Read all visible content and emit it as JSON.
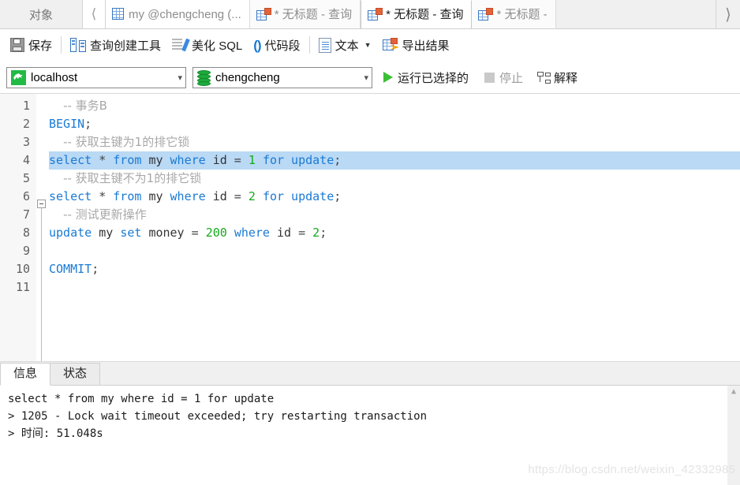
{
  "tabbar": {
    "object_label": "对象",
    "nav_left_icon": "chevron-left-icon",
    "nav_right_icon": "chevron-right-icon",
    "tabs": [
      {
        "label": "my @chengcheng (...",
        "icon": "table-grid-icon",
        "active": false
      },
      {
        "label": "* 无标题 - 查询",
        "icon": "query-table-icon",
        "active": false
      },
      {
        "label": "* 无标题 - 查询",
        "icon": "query-table-icon",
        "active": true
      },
      {
        "label": "* 无标题 -",
        "icon": "query-table-icon",
        "active": false
      }
    ]
  },
  "toolbar": {
    "save_label": "保存",
    "query_builder_label": "查询创建工具",
    "beautify_label": "美化 SQL",
    "code_snippet_label": "代码段",
    "text_label": "文本",
    "export_label": "导出结果"
  },
  "connbar": {
    "host_value": "localhost",
    "database_value": "chengcheng",
    "run_selected_label": "运行已选择的",
    "stop_label": "停止",
    "explain_label": "解释"
  },
  "editor": {
    "lines": [
      {
        "n": "1",
        "tokens": [
          {
            "t": "  ",
            "c": "pl"
          },
          {
            "t": "-- 事务B",
            "c": "cm"
          }
        ]
      },
      {
        "n": "2",
        "tokens": [
          {
            "t": "BEGIN",
            "c": "k"
          },
          {
            "t": ";",
            "c": "op"
          }
        ]
      },
      {
        "n": "3",
        "tokens": [
          {
            "t": "  ",
            "c": "pl"
          },
          {
            "t": "-- 获取主键为1的排它锁",
            "c": "cm"
          }
        ]
      },
      {
        "n": "4",
        "selected": true,
        "tokens": [
          {
            "t": "select",
            "c": "k"
          },
          {
            "t": " ",
            "c": "pl"
          },
          {
            "t": "*",
            "c": "op"
          },
          {
            "t": " ",
            "c": "pl"
          },
          {
            "t": "from",
            "c": "k"
          },
          {
            "t": " ",
            "c": "pl"
          },
          {
            "t": "my",
            "c": "pl"
          },
          {
            "t": " ",
            "c": "pl"
          },
          {
            "t": "where",
            "c": "k"
          },
          {
            "t": " ",
            "c": "pl"
          },
          {
            "t": "id",
            "c": "pl"
          },
          {
            "t": " = ",
            "c": "op"
          },
          {
            "t": "1",
            "c": "num"
          },
          {
            "t": " ",
            "c": "pl"
          },
          {
            "t": "for update",
            "c": "k"
          },
          {
            "t": ";",
            "c": "op"
          }
        ]
      },
      {
        "n": "5",
        "tokens": [
          {
            "t": "  ",
            "c": "pl"
          },
          {
            "t": "-- 获取主键不为1的排它锁",
            "c": "cm"
          }
        ]
      },
      {
        "n": "6",
        "tokens": [
          {
            "t": "select",
            "c": "k"
          },
          {
            "t": " ",
            "c": "pl"
          },
          {
            "t": "*",
            "c": "op"
          },
          {
            "t": " ",
            "c": "pl"
          },
          {
            "t": "from",
            "c": "k"
          },
          {
            "t": " ",
            "c": "pl"
          },
          {
            "t": "my",
            "c": "pl"
          },
          {
            "t": " ",
            "c": "pl"
          },
          {
            "t": "where",
            "c": "k"
          },
          {
            "t": " ",
            "c": "pl"
          },
          {
            "t": "id",
            "c": "pl"
          },
          {
            "t": " = ",
            "c": "op"
          },
          {
            "t": "2",
            "c": "num"
          },
          {
            "t": " ",
            "c": "pl"
          },
          {
            "t": "for update",
            "c": "k"
          },
          {
            "t": ";",
            "c": "op"
          }
        ]
      },
      {
        "n": "7",
        "tokens": [
          {
            "t": "  ",
            "c": "pl"
          },
          {
            "t": "-- 测试更新操作",
            "c": "cm"
          }
        ]
      },
      {
        "n": "8",
        "tokens": [
          {
            "t": "update",
            "c": "k"
          },
          {
            "t": " ",
            "c": "pl"
          },
          {
            "t": "my",
            "c": "pl"
          },
          {
            "t": " ",
            "c": "pl"
          },
          {
            "t": "set",
            "c": "k"
          },
          {
            "t": " ",
            "c": "pl"
          },
          {
            "t": "money",
            "c": "pl"
          },
          {
            "t": " = ",
            "c": "op"
          },
          {
            "t": "200",
            "c": "num"
          },
          {
            "t": " ",
            "c": "pl"
          },
          {
            "t": "where",
            "c": "k"
          },
          {
            "t": " ",
            "c": "pl"
          },
          {
            "t": "id",
            "c": "pl"
          },
          {
            "t": " = ",
            "c": "op"
          },
          {
            "t": "2",
            "c": "num"
          },
          {
            "t": ";",
            "c": "op"
          }
        ]
      },
      {
        "n": "9",
        "tokens": []
      },
      {
        "n": "10",
        "tokens": [
          {
            "t": "COMMIT",
            "c": "k"
          },
          {
            "t": ";",
            "c": "op"
          }
        ]
      },
      {
        "n": "11",
        "tokens": []
      }
    ]
  },
  "bottom": {
    "tabs": [
      {
        "label": "信息",
        "active": true
      },
      {
        "label": "状态",
        "active": false
      }
    ],
    "result_lines": [
      "select * from my where id = 1 for update",
      "> 1205 - Lock wait timeout exceeded; try restarting transaction",
      "> 时间: 51.048s"
    ],
    "scroll_up_icon": "chevron-up-icon"
  },
  "watermark": "https://blog.csdn.net/weixin_42332985"
}
